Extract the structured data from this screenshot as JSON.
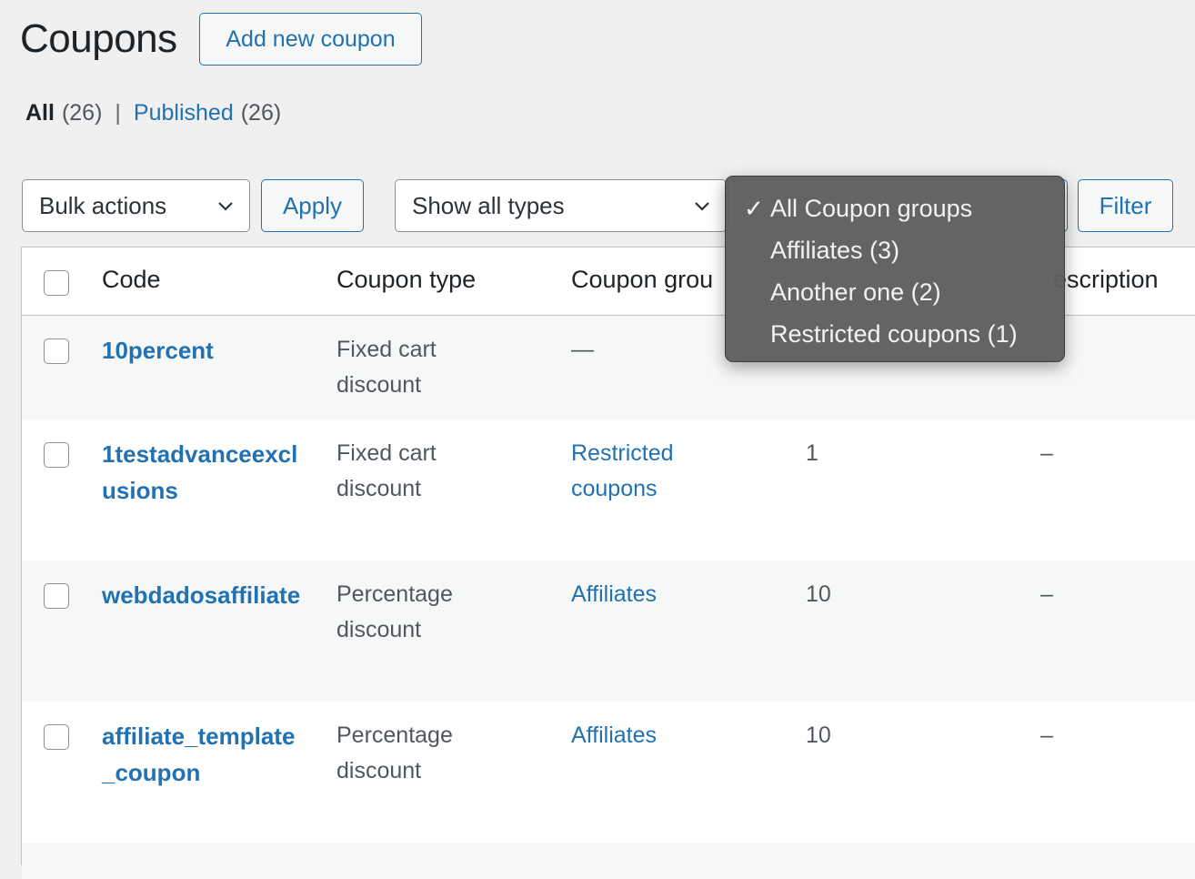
{
  "header": {
    "title": "Coupons",
    "add_new_label": "Add new coupon"
  },
  "views": [
    {
      "label": "All",
      "count": "(26)",
      "current": true
    },
    {
      "label": "Published",
      "count": "(26)",
      "current": false
    }
  ],
  "views_separator": "|",
  "toolbar": {
    "bulk_actions": "Bulk actions",
    "apply_label": "Apply",
    "type_filter": "Show all types",
    "filter_label": "Filter"
  },
  "group_dropdown": {
    "options": [
      {
        "label": "All Coupon groups",
        "selected": true
      },
      {
        "label": "Affiliates (3)",
        "selected": false
      },
      {
        "label": "Another one (2)",
        "selected": false
      },
      {
        "label": "Restricted coupons (1)",
        "selected": false
      }
    ],
    "check_glyph": "✓"
  },
  "table": {
    "columns": {
      "code": "Code",
      "type": "Coupon type",
      "group": "Coupon grou",
      "description": "escription"
    },
    "rows": [
      {
        "code": "10percent",
        "type": "Fixed cart discount",
        "group": "—",
        "usage": "",
        "description": ""
      },
      {
        "code": "1testadvanceexclusions",
        "type": "Fixed cart discount",
        "group": "Restricted coupons",
        "usage": "1",
        "description": "–"
      },
      {
        "code": "webdadosaffiliate",
        "type": "Percentage discount",
        "group": "Affiliates",
        "usage": "10",
        "description": "–"
      },
      {
        "code": "affiliate_template_coupon",
        "type": "Percentage discount",
        "group": "Affiliates",
        "usage": "10",
        "description": "–"
      }
    ]
  },
  "colors": {
    "link": "#2271b1",
    "background": "#f0f0f1",
    "dropdown_bg": "#5f605e"
  }
}
